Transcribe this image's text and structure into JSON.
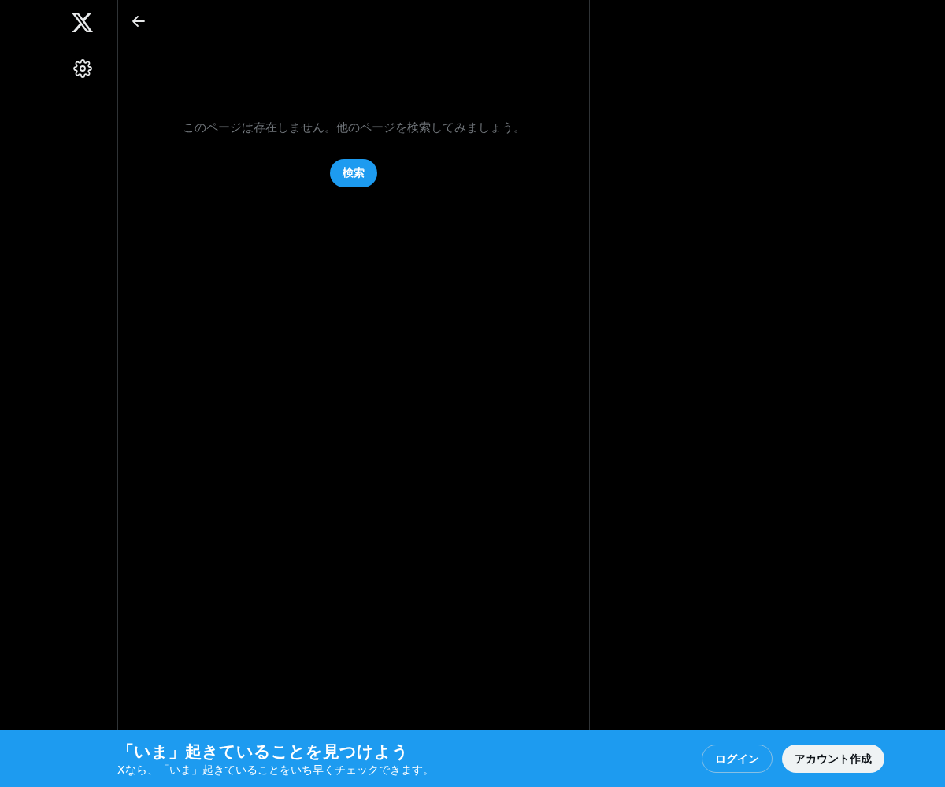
{
  "main": {
    "message": "このページは存在しません。他のページを検索してみましょう。",
    "search_button": "検索"
  },
  "bottom_banner": {
    "title": "「いま」起きていることを見つけよう",
    "subtitle": "Xなら、「いま」起きていることをいち早くチェックできます。",
    "login_button": "ログイン",
    "signup_button": "アカウント作成"
  }
}
